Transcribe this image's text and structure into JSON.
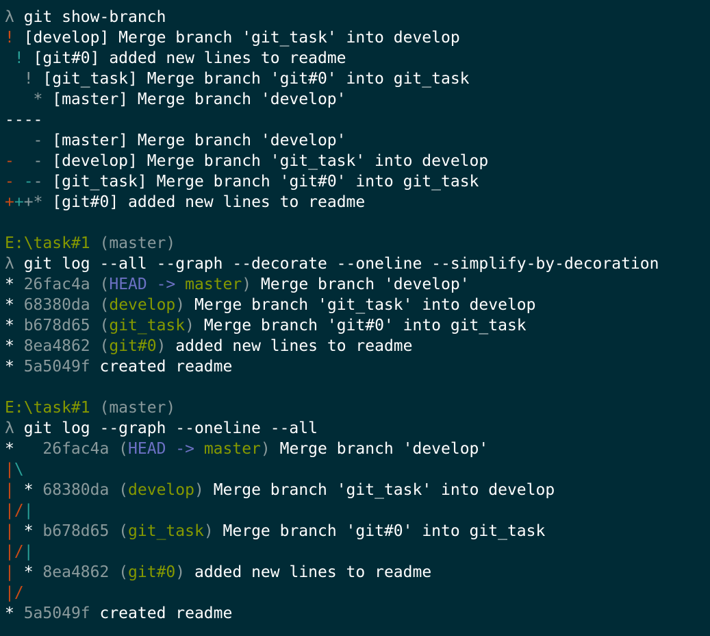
{
  "colors": {
    "background": "#002b36",
    "text": "#ffffff",
    "dim": "#8a9a9c",
    "red": "#cb4b16",
    "cyan": "#2aa198",
    "olive": "#859900",
    "blue": "#6c71c4",
    "white": "#ffffff"
  },
  "lines": [
    {
      "kind": "command",
      "segments": [
        {
          "text": "λ",
          "color": "dim"
        },
        {
          "text": " git show-branch",
          "color": "white"
        }
      ]
    },
    {
      "kind": "output",
      "segments": [
        {
          "text": "!",
          "color": "red"
        },
        {
          "text": " [develop] Merge branch 'git_task' into develop",
          "color": "white"
        }
      ]
    },
    {
      "kind": "output",
      "segments": [
        {
          "text": " !",
          "color": "cyan"
        },
        {
          "text": " [git#0] added new lines to readme",
          "color": "white"
        }
      ]
    },
    {
      "kind": "output",
      "segments": [
        {
          "text": "  !",
          "color": "dim"
        },
        {
          "text": " [git_task] Merge branch 'git#0' into git_task",
          "color": "white"
        }
      ]
    },
    {
      "kind": "output",
      "segments": [
        {
          "text": "   *",
          "color": "dim"
        },
        {
          "text": " [master] Merge branch 'develop'",
          "color": "white"
        }
      ]
    },
    {
      "kind": "output",
      "segments": [
        {
          "text": "----",
          "color": "white"
        }
      ]
    },
    {
      "kind": "output",
      "segments": [
        {
          "text": "   -",
          "color": "dim"
        },
        {
          "text": " [master] Merge branch 'develop'",
          "color": "white"
        }
      ]
    },
    {
      "kind": "output",
      "segments": [
        {
          "text": "-",
          "color": "red"
        },
        {
          "text": "  -",
          "color": "dim"
        },
        {
          "text": " [develop] Merge branch 'git_task' into develop",
          "color": "white"
        }
      ]
    },
    {
      "kind": "output",
      "segments": [
        {
          "text": "-",
          "color": "red"
        },
        {
          "text": " -",
          "color": "cyan"
        },
        {
          "text": "-",
          "color": "dim"
        },
        {
          "text": " [git_task] Merge branch 'git#0' into git_task",
          "color": "white"
        }
      ]
    },
    {
      "kind": "output",
      "segments": [
        {
          "text": "+",
          "color": "red"
        },
        {
          "text": "+",
          "color": "cyan"
        },
        {
          "text": "+",
          "color": "dim"
        },
        {
          "text": "*",
          "color": "dim"
        },
        {
          "text": " [git#0] added new lines to readme",
          "color": "white"
        }
      ]
    },
    {
      "kind": "blank",
      "segments": []
    },
    {
      "kind": "prompt",
      "segments": [
        {
          "text": "E:\\task#1",
          "color": "olive"
        },
        {
          "text": " (master)",
          "color": "dim"
        }
      ]
    },
    {
      "kind": "command",
      "segments": [
        {
          "text": "λ",
          "color": "dim"
        },
        {
          "text": " git log --all --graph --decorate --oneline --simplify-by-decoration",
          "color": "white"
        }
      ]
    },
    {
      "kind": "output",
      "segments": [
        {
          "text": "* ",
          "color": "white"
        },
        {
          "text": "26fac4a",
          "color": "dim"
        },
        {
          "text": " (",
          "color": "dim"
        },
        {
          "text": "HEAD -> ",
          "color": "blue"
        },
        {
          "text": "master",
          "color": "olive"
        },
        {
          "text": ")",
          "color": "dim"
        },
        {
          "text": " Merge branch 'develop'",
          "color": "white"
        }
      ]
    },
    {
      "kind": "output",
      "segments": [
        {
          "text": "* ",
          "color": "white"
        },
        {
          "text": "68380da",
          "color": "dim"
        },
        {
          "text": " (",
          "color": "dim"
        },
        {
          "text": "develop",
          "color": "olive"
        },
        {
          "text": ")",
          "color": "dim"
        },
        {
          "text": " Merge branch 'git_task' into develop",
          "color": "white"
        }
      ]
    },
    {
      "kind": "output",
      "segments": [
        {
          "text": "* ",
          "color": "white"
        },
        {
          "text": "b678d65",
          "color": "dim"
        },
        {
          "text": " (",
          "color": "dim"
        },
        {
          "text": "git_task",
          "color": "olive"
        },
        {
          "text": ")",
          "color": "dim"
        },
        {
          "text": " Merge branch 'git#0' into git_task",
          "color": "white"
        }
      ]
    },
    {
      "kind": "output",
      "segments": [
        {
          "text": "* ",
          "color": "white"
        },
        {
          "text": "8ea4862",
          "color": "dim"
        },
        {
          "text": " (",
          "color": "dim"
        },
        {
          "text": "git#0",
          "color": "olive"
        },
        {
          "text": ")",
          "color": "dim"
        },
        {
          "text": " added new lines to readme",
          "color": "white"
        }
      ]
    },
    {
      "kind": "output",
      "segments": [
        {
          "text": "* ",
          "color": "white"
        },
        {
          "text": "5a5049f",
          "color": "dim"
        },
        {
          "text": " created readme",
          "color": "white"
        }
      ]
    },
    {
      "kind": "blank",
      "segments": []
    },
    {
      "kind": "prompt",
      "segments": [
        {
          "text": "E:\\task#1",
          "color": "olive"
        },
        {
          "text": " (master)",
          "color": "dim"
        }
      ]
    },
    {
      "kind": "command",
      "segments": [
        {
          "text": "λ",
          "color": "dim"
        },
        {
          "text": " git log --graph --oneline --all",
          "color": "white"
        }
      ]
    },
    {
      "kind": "output",
      "segments": [
        {
          "text": "*   ",
          "color": "white"
        },
        {
          "text": "26fac4a",
          "color": "dim"
        },
        {
          "text": " (",
          "color": "dim"
        },
        {
          "text": "HEAD -> ",
          "color": "blue"
        },
        {
          "text": "master",
          "color": "olive"
        },
        {
          "text": ")",
          "color": "dim"
        },
        {
          "text": " Merge branch 'develop'",
          "color": "white"
        }
      ]
    },
    {
      "kind": "graph",
      "segments": [
        {
          "text": "|",
          "color": "red"
        },
        {
          "text": "\\",
          "color": "cyan"
        }
      ]
    },
    {
      "kind": "output",
      "segments": [
        {
          "text": "|",
          "color": "red"
        },
        {
          "text": " * ",
          "color": "white"
        },
        {
          "text": "68380da",
          "color": "dim"
        },
        {
          "text": " (",
          "color": "dim"
        },
        {
          "text": "develop",
          "color": "olive"
        },
        {
          "text": ")",
          "color": "dim"
        },
        {
          "text": " Merge branch 'git_task' into develop",
          "color": "white"
        }
      ]
    },
    {
      "kind": "graph",
      "segments": [
        {
          "text": "|",
          "color": "red"
        },
        {
          "text": "/",
          "color": "red"
        },
        {
          "text": "|",
          "color": "cyan"
        }
      ]
    },
    {
      "kind": "output",
      "segments": [
        {
          "text": "|",
          "color": "red"
        },
        {
          "text": " * ",
          "color": "white"
        },
        {
          "text": "b678d65",
          "color": "dim"
        },
        {
          "text": " (",
          "color": "dim"
        },
        {
          "text": "git_task",
          "color": "olive"
        },
        {
          "text": ")",
          "color": "dim"
        },
        {
          "text": " Merge branch 'git#0' into git_task",
          "color": "white"
        }
      ]
    },
    {
      "kind": "graph",
      "segments": [
        {
          "text": "|",
          "color": "red"
        },
        {
          "text": "/",
          "color": "red"
        },
        {
          "text": "|",
          "color": "cyan"
        }
      ]
    },
    {
      "kind": "output",
      "segments": [
        {
          "text": "|",
          "color": "red"
        },
        {
          "text": " * ",
          "color": "white"
        },
        {
          "text": "8ea4862",
          "color": "dim"
        },
        {
          "text": " (",
          "color": "dim"
        },
        {
          "text": "git#0",
          "color": "olive"
        },
        {
          "text": ")",
          "color": "dim"
        },
        {
          "text": " added new lines to readme",
          "color": "white"
        }
      ]
    },
    {
      "kind": "graph",
      "segments": [
        {
          "text": "|",
          "color": "red"
        },
        {
          "text": "/",
          "color": "red"
        }
      ]
    },
    {
      "kind": "output",
      "segments": [
        {
          "text": "* ",
          "color": "white"
        },
        {
          "text": "5a5049f",
          "color": "dim"
        },
        {
          "text": " created readme",
          "color": "white"
        }
      ]
    }
  ]
}
